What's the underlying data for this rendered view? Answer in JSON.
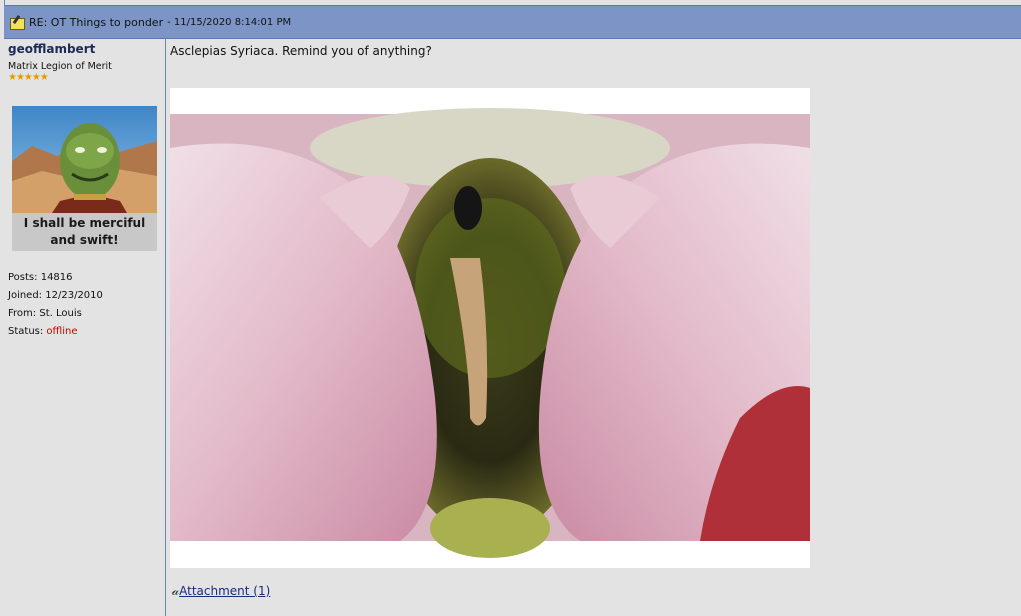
{
  "header": {
    "title": "RE: OT Things to ponder",
    "separator": " - ",
    "date": "11/15/2020 8:14:01 PM",
    "icon": "post-icon"
  },
  "author": {
    "username": "geofflambert",
    "rank": "Matrix Legion of Merit",
    "stars": "★★★★★",
    "avatar_caption_line1": "I shall be merciful",
    "avatar_caption_line2": "and swift!",
    "posts_label": "Posts:",
    "posts": "14816",
    "joined_label": "Joined:",
    "joined": "12/23/2010",
    "from_label": "From:",
    "from": "St. Louis",
    "status_label": "Status:",
    "status": "offline"
  },
  "post": {
    "text": "Asclepias Syriaca. Remind you of anything?",
    "attachment_label": "Attachment (1)",
    "attachment_icon": "paperclip-icon"
  },
  "colors": {
    "header_bg": "#7d95c6",
    "page_bg": "#e3e3e3",
    "username": "#1b2a57",
    "offline": "#cc0000",
    "link": "#1b2a7a"
  }
}
